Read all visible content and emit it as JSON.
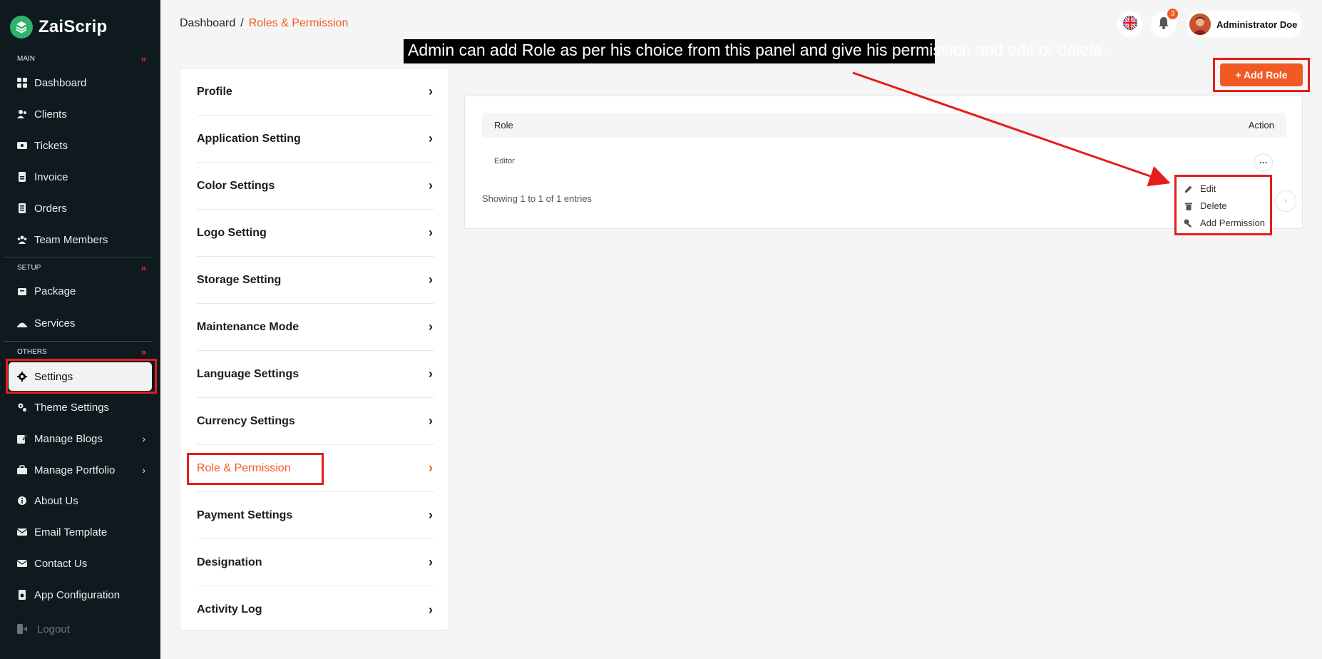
{
  "brand": {
    "name": "ZaiScrip"
  },
  "sidebar": {
    "sections": {
      "main": "MAIN",
      "setup": "SETUP",
      "others": "OTHERS"
    },
    "main_items": [
      {
        "label": "Dashboard",
        "icon": "grid-icon"
      },
      {
        "label": "Clients",
        "icon": "users-icon"
      },
      {
        "label": "Tickets",
        "icon": "ticket-icon"
      },
      {
        "label": "Invoice",
        "icon": "invoice-icon"
      },
      {
        "label": "Orders",
        "icon": "orders-icon"
      },
      {
        "label": "Team Members",
        "icon": "team-icon"
      }
    ],
    "setup_items": [
      {
        "label": "Package",
        "icon": "package-icon"
      },
      {
        "label": "Services",
        "icon": "services-icon"
      }
    ],
    "other_items": [
      {
        "label": "Settings",
        "icon": "gear-icon"
      },
      {
        "label": "Theme Settings",
        "icon": "gears-icon"
      },
      {
        "label": "Manage Blogs",
        "icon": "blog-icon"
      },
      {
        "label": "Manage Portfolio",
        "icon": "portfolio-icon"
      },
      {
        "label": "About Us",
        "icon": "info-icon"
      },
      {
        "label": "Email Template",
        "icon": "mail-icon"
      },
      {
        "label": "Contact Us",
        "icon": "contact-icon"
      },
      {
        "label": "App Configuration",
        "icon": "config-icon"
      }
    ],
    "logout": "Logout"
  },
  "header": {
    "breadcrumb_root": "Dashboard",
    "breadcrumb_sep": "/",
    "breadcrumb_current": "Roles & Permission",
    "notification_count": "3",
    "user_name": "Administrator Doe"
  },
  "settings_menu": [
    "Profile",
    "Application Setting",
    "Color Settings",
    "Logo Setting",
    "Storage Setting",
    "Maintenance Mode",
    "Language Settings",
    "Currency Settings",
    "Role & Permission",
    "Payment Settings",
    "Designation",
    "Activity Log"
  ],
  "roles": {
    "add_button": "+ Add Role",
    "col_role": "Role",
    "col_action": "Action",
    "rows": [
      {
        "role": "Editor"
      }
    ],
    "showing": "Showing 1 to 1 of 1 entries",
    "more": "···"
  },
  "action_menu": {
    "edit": "Edit",
    "delete": "Delete",
    "add_permission": "Add Permission"
  },
  "annotation": "Admin can add Role as per his choice from this panel and give his permission and edit or delete.",
  "colors": {
    "accent": "#f25a23",
    "sidebar_bg": "#0f1a1f",
    "highlight": "#e41d1d"
  }
}
